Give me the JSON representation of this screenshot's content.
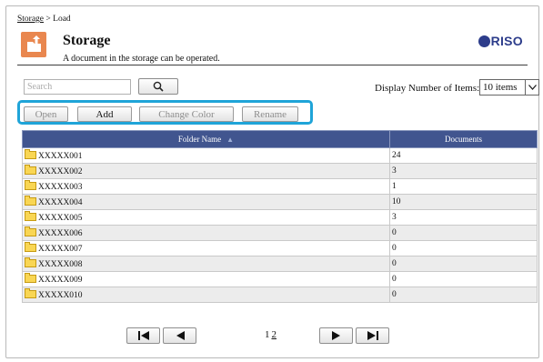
{
  "breadcrumb": {
    "link": "Storage",
    "separator": " > ",
    "current": "Load"
  },
  "header": {
    "title": "Storage",
    "subtitle": "A document in the storage can be operated.",
    "logo": "RISO",
    "icon": "storage-upload-icon",
    "accent": "#e9874f",
    "brand_color": "#2d3d8b"
  },
  "search": {
    "placeholder": "Search",
    "button_icon": "search-icon"
  },
  "display": {
    "label": "Display Number of Items:",
    "selected": "10 items"
  },
  "toolbar": {
    "open": "Open",
    "add": "Add",
    "change_color": "Change Color",
    "rename": "Rename",
    "highlight_color": "#1fa4d8"
  },
  "table": {
    "columns": [
      "Folder Name",
      "Documents"
    ],
    "header_color": "#41558f",
    "rows": [
      {
        "name": "XXXXX001",
        "docs": "24"
      },
      {
        "name": "XXXXX002",
        "docs": "3"
      },
      {
        "name": "XXXXX003",
        "docs": "1"
      },
      {
        "name": "XXXXX004",
        "docs": "10"
      },
      {
        "name": "XXXXX005",
        "docs": "3"
      },
      {
        "name": "XXXXX006",
        "docs": "0"
      },
      {
        "name": "XXXXX007",
        "docs": "0"
      },
      {
        "name": "XXXXX008",
        "docs": "0"
      },
      {
        "name": "XXXXX009",
        "docs": "0"
      },
      {
        "name": "XXXXX010",
        "docs": "0"
      }
    ]
  },
  "pagination": {
    "current": "1",
    "next": "2"
  }
}
